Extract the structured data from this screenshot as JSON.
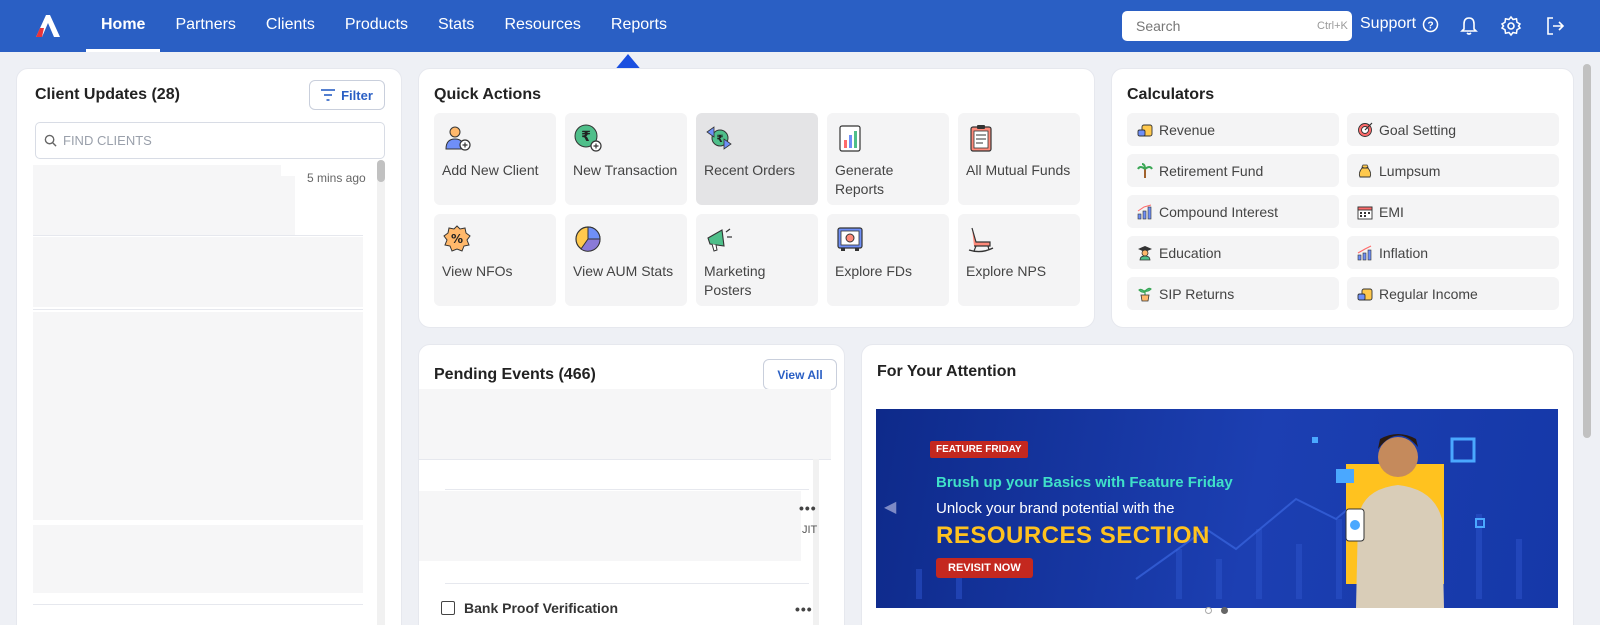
{
  "nav": {
    "items": [
      "Home",
      "Partners",
      "Clients",
      "Products",
      "Stats",
      "Resources",
      "Reports"
    ],
    "active": "Home"
  },
  "search": {
    "placeholder": "Search",
    "shortcut": "Ctrl+K"
  },
  "support": {
    "label": "Support"
  },
  "client_updates": {
    "title": "Client Updates (28)",
    "filter_label": "Filter",
    "find_placeholder": "FIND CLIENTS",
    "first_time": "5 mins ago"
  },
  "quick_actions": {
    "title": "Quick Actions",
    "tiles": [
      {
        "label": "Add New Client",
        "icon": "add-user-icon"
      },
      {
        "label": "New Transaction",
        "icon": "rupee-add-icon"
      },
      {
        "label": "Recent Orders",
        "icon": "exchange-money-icon"
      },
      {
        "label": "Generate Reports",
        "icon": "report-chart-icon"
      },
      {
        "label": "All Mutual Funds",
        "icon": "clipboard-icon"
      },
      {
        "label": "View NFOs",
        "icon": "percent-badge-icon"
      },
      {
        "label": "View AUM Stats",
        "icon": "pie-chart-icon"
      },
      {
        "label": "Marketing Posters",
        "icon": "megaphone-icon"
      },
      {
        "label": "Explore FDs",
        "icon": "safe-vault-icon"
      },
      {
        "label": "Explore NPS",
        "icon": "rocking-chair-icon"
      }
    ]
  },
  "calculators": {
    "title": "Calculators",
    "items": [
      {
        "label": "Revenue",
        "icon": "coins-icon"
      },
      {
        "label": "Goal Setting",
        "icon": "target-icon"
      },
      {
        "label": "Retirement Fund",
        "icon": "palm-tree-icon"
      },
      {
        "label": "Lumpsum",
        "icon": "money-bag-icon"
      },
      {
        "label": "Compound Interest",
        "icon": "bar-growth-icon"
      },
      {
        "label": "EMI",
        "icon": "calendar-icon"
      },
      {
        "label": "Education",
        "icon": "graduate-icon"
      },
      {
        "label": "Inflation",
        "icon": "chart-up-icon"
      },
      {
        "label": "SIP Returns",
        "icon": "plant-pot-icon"
      },
      {
        "label": "Regular Income",
        "icon": "coins-stack-icon"
      }
    ]
  },
  "pending": {
    "title": "Pending Events (466)",
    "view_all": "View All",
    "partial_text": "JIT",
    "row_label": "Bank Proof Verification"
  },
  "attention": {
    "title": "For Your Attention",
    "banner": {
      "badge": "FEATURE FRIDAY",
      "line1": "Brush up your Basics with Feature Friday",
      "line2": "Unlock your brand potential with the",
      "line3": "RESOURCES SECTION",
      "cta": "REVISIT NOW"
    },
    "slides": 2,
    "active_slide": 2
  },
  "colors": {
    "brand": "#2a5fc4",
    "annotation_arrow": "#1a4fe0"
  }
}
